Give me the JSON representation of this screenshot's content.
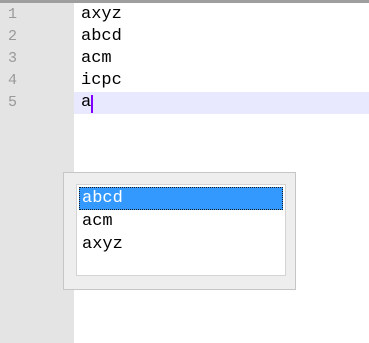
{
  "editor": {
    "lines": [
      {
        "number": "1",
        "text": "axyz"
      },
      {
        "number": "2",
        "text": "abcd"
      },
      {
        "number": "3",
        "text": "acm"
      },
      {
        "number": "4",
        "text": "icpc"
      },
      {
        "number": "5",
        "text": "a"
      }
    ],
    "current_line": 5,
    "highlight_color": "#e8e8ff",
    "caret_color": "#8000ff"
  },
  "autocomplete": {
    "items": [
      {
        "label": "abcd",
        "selected": true
      },
      {
        "label": "acm",
        "selected": false
      },
      {
        "label": "axyz",
        "selected": false
      }
    ],
    "selected_color": "#3399ff"
  }
}
